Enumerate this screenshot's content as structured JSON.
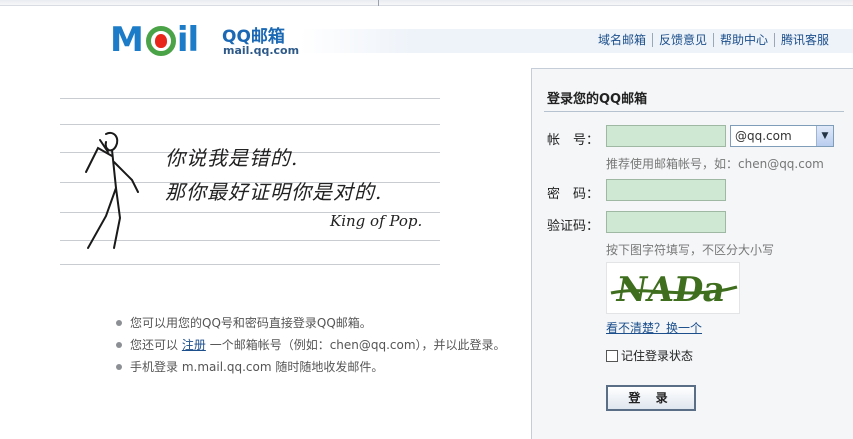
{
  "header": {
    "logo_m": "M",
    "logo_il": "il",
    "logo_brand": "QQ邮箱",
    "logo_url": "mail.qq.com",
    "links": [
      "域名邮箱",
      "反馈意见",
      "帮助中心",
      "腾讯客服"
    ]
  },
  "quote": {
    "line1": "你说我是错的.",
    "line2": "那你最好证明你是对的.",
    "signature": "King of Pop."
  },
  "tips": {
    "item1": "您可以用您的QQ号和密码直接登录QQ邮箱。",
    "item2_prefix": "您还可以",
    "item2_link": "注册",
    "item2_suffix": "一个邮箱帐号（例如：chen@qq.com），并以此登录。",
    "item3": "手机登录 m.mail.qq.com 随时随地收发邮件。"
  },
  "login": {
    "title": "登录您的QQ邮箱",
    "account_label": "帐　号：",
    "account_value": "",
    "domain_selected": "@qq.com",
    "account_hint": "推荐使用邮箱帐号，如：chen@qq.com",
    "password_label": "密　码：",
    "password_value": "",
    "captcha_label": "验证码：",
    "captcha_value": "",
    "captcha_hint": "按下图字符填写，不区分大小写",
    "captcha_text": "NADa",
    "change_link": "看不清楚？换一个",
    "remember_label": "记住登录状态",
    "login_button": "登 录"
  }
}
